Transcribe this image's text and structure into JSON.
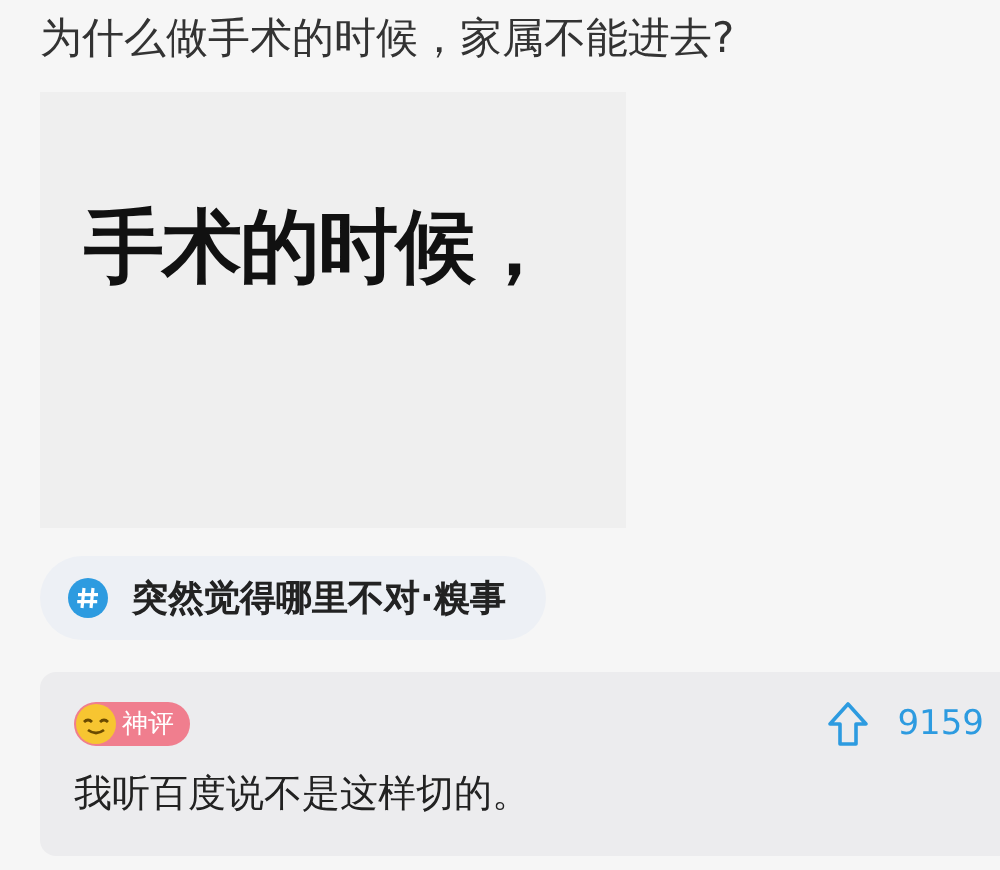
{
  "question": {
    "title": "为什么做手术的时候，家属不能进去?"
  },
  "image": {
    "text": "手术的时候，"
  },
  "topic": {
    "label": "突然觉得哪里不对·糗事"
  },
  "comment": {
    "badge": "神评",
    "upvotes": "9159",
    "text": "我听百度说不是这样切的。"
  }
}
